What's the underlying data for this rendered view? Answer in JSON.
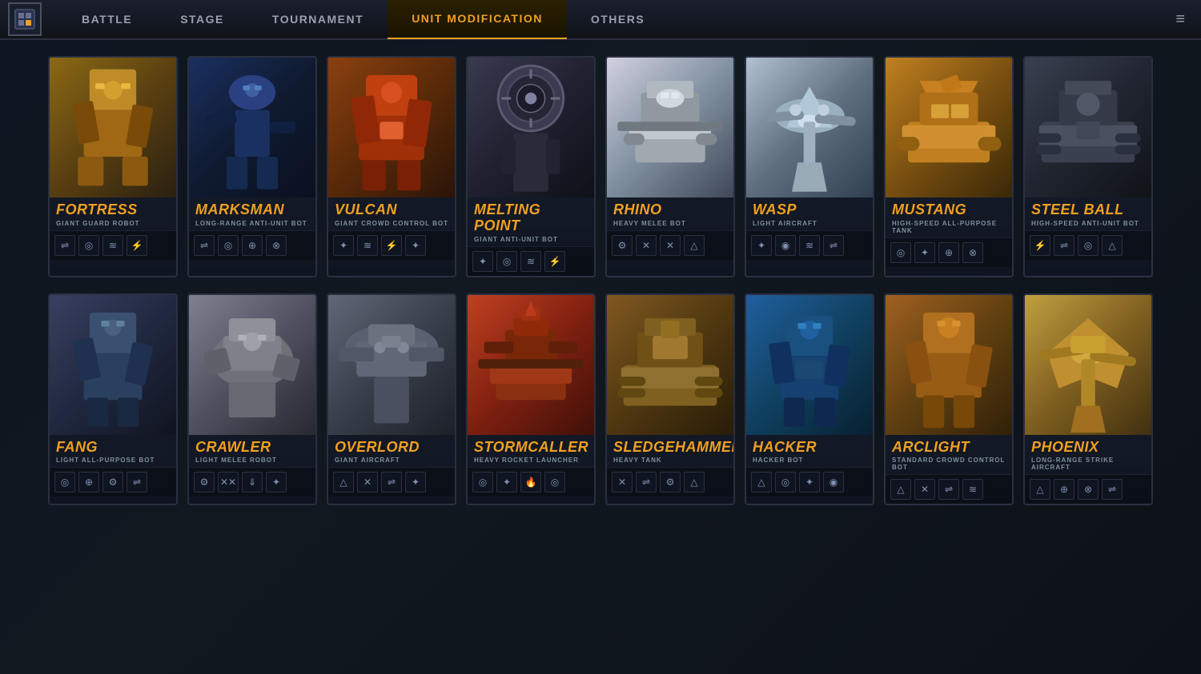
{
  "nav": {
    "tabs": [
      {
        "id": "battle",
        "label": "BATTLE",
        "active": false
      },
      {
        "id": "stage",
        "label": "STAGE",
        "active": false
      },
      {
        "id": "tournament",
        "label": "TOURNAMENT",
        "active": false
      },
      {
        "id": "unit_modification",
        "label": "UNIT MODIFICATION",
        "active": true
      },
      {
        "id": "others",
        "label": "OTHERS",
        "active": false
      }
    ],
    "menu_icon": "≡"
  },
  "units_row1": [
    {
      "id": "fortress",
      "name": "Fortress",
      "type": "GIANT GUARD ROBOT",
      "icons": [
        "⇄",
        "◎",
        "≋",
        "⚡"
      ],
      "card_class": "card-fortress"
    },
    {
      "id": "marksman",
      "name": "Marksman",
      "type": "LONG-RANGE ANTI-UNIT BOT",
      "icons": [
        "⇄",
        "◎",
        "⊕",
        "⊗"
      ],
      "card_class": "card-marksman"
    },
    {
      "id": "vulcan",
      "name": "Vulcan",
      "type": "GIANT CROWD CONTROL BOT",
      "icons": [
        "✦",
        "≋",
        "⚡",
        "✦"
      ],
      "card_class": "card-vulcan"
    },
    {
      "id": "melting_point",
      "name": "Melting Point",
      "type": "GIANT ANTI-UNIT BOT",
      "icons": [
        "✦",
        "◎",
        "≋",
        "⚡"
      ],
      "card_class": "card-melting"
    },
    {
      "id": "rhino",
      "name": "RHINO",
      "type": "HEAVY MELEE BOT",
      "icons": [
        "⚙",
        "✕",
        "✕",
        "△"
      ],
      "card_class": "card-rhino"
    },
    {
      "id": "wasp",
      "name": "WASP",
      "type": "LIGHT AIRCRAFT",
      "icons": [
        "✦",
        "◉",
        "≋",
        "⇄"
      ],
      "card_class": "card-wasp"
    },
    {
      "id": "mustang",
      "name": "MUSTANG",
      "type": "HIGH-SPEED ALL-PURPOSE TANK",
      "icons": [
        "◎",
        "✦",
        "⊕",
        "⊗"
      ],
      "card_class": "card-mustang"
    },
    {
      "id": "steel_ball",
      "name": "Steel Ball",
      "type": "HIGH-SPEED ANTI-UNIT BOT",
      "icons": [
        "⚡",
        "⇄",
        "◎",
        "△"
      ],
      "card_class": "card-steelball"
    }
  ],
  "units_row2": [
    {
      "id": "fang",
      "name": "Fang",
      "type": "LIGHT ALL-PURPOSE BOT",
      "icons": [
        "◎",
        "⊕",
        "⚙",
        "⇄"
      ],
      "card_class": "card-fang"
    },
    {
      "id": "crawler",
      "name": "Crawler",
      "type": "LIGHT MELEE ROBOT",
      "icons": [
        "⚙",
        "✕✕",
        "⇓",
        "✦"
      ],
      "card_class": "card-crawler"
    },
    {
      "id": "overlord",
      "name": "Overlord",
      "type": "GIANT AIRCRAFT",
      "icons": [
        "△",
        "✕",
        "⇄",
        "✦"
      ],
      "card_class": "card-overlord"
    },
    {
      "id": "stormcaller",
      "name": "Stormcaller",
      "type": "HEAVY ROCKET LAUNCHER",
      "icons": [
        "◎",
        "✦",
        "🔥",
        "◎"
      ],
      "card_class": "card-stormcaller"
    },
    {
      "id": "sledgehammer",
      "name": "Sledgehammer",
      "type": "HEAVY TANK",
      "icons": [
        "✕",
        "⇄",
        "⚙",
        "△"
      ],
      "card_class": "card-sledgehammer"
    },
    {
      "id": "hacker",
      "name": "Hacker",
      "type": "HACKER BOT",
      "icons": [
        "△",
        "◎",
        "✦",
        "◉"
      ],
      "card_class": "card-hacker"
    },
    {
      "id": "arclight",
      "name": "Arclight",
      "type": "STANDARD CROWD CONTROL BOT",
      "icons": [
        "△",
        "✕",
        "⇄",
        "≋"
      ],
      "card_class": "card-arclight"
    },
    {
      "id": "phoenix",
      "name": "PHOENIX",
      "type": "LONG-RANGE STRIKE AIRCRAFT",
      "icons": [
        "△",
        "⊕",
        "⊗",
        "⇄"
      ],
      "card_class": "card-phoenix"
    }
  ]
}
